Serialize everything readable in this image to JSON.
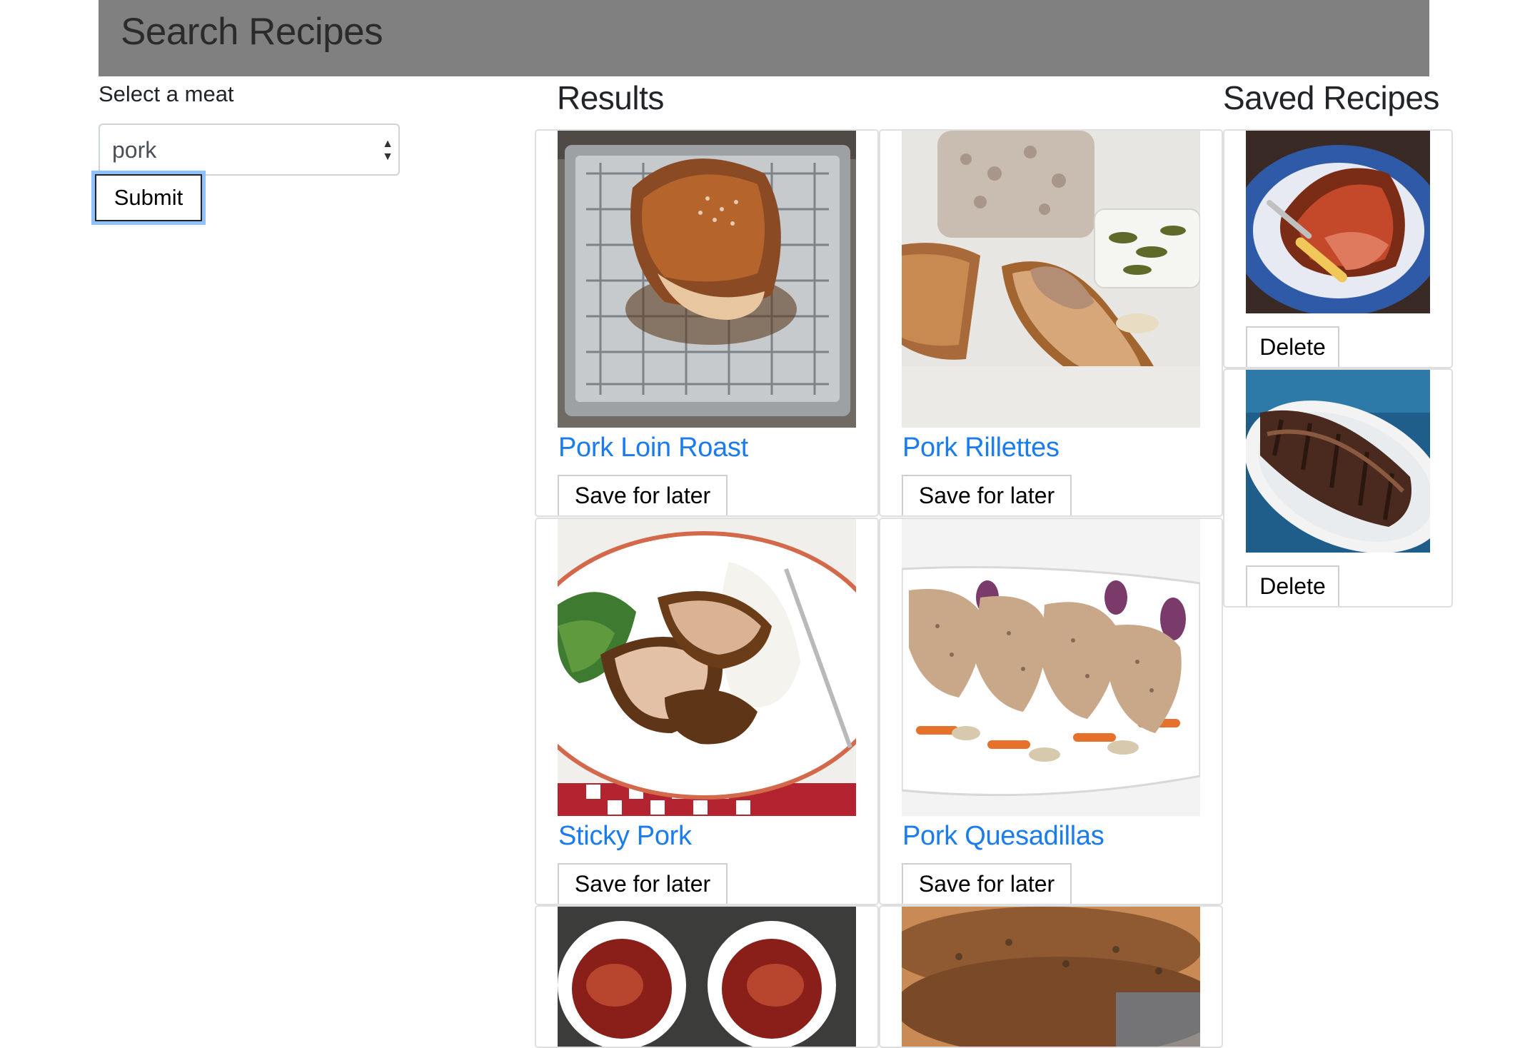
{
  "header": {
    "title": "Search Recipes"
  },
  "search": {
    "label": "Select a meat",
    "selected": "pork",
    "submit_label": "Submit"
  },
  "results": {
    "title": "Results",
    "save_label": "Save for later",
    "items": [
      {
        "name": "Pork Loin Roast"
      },
      {
        "name": "Pork Rillettes"
      },
      {
        "name": "Sticky Pork"
      },
      {
        "name": "Pork Quesadillas"
      }
    ]
  },
  "saved": {
    "title": "Saved Recipes",
    "delete_label": "Delete"
  }
}
